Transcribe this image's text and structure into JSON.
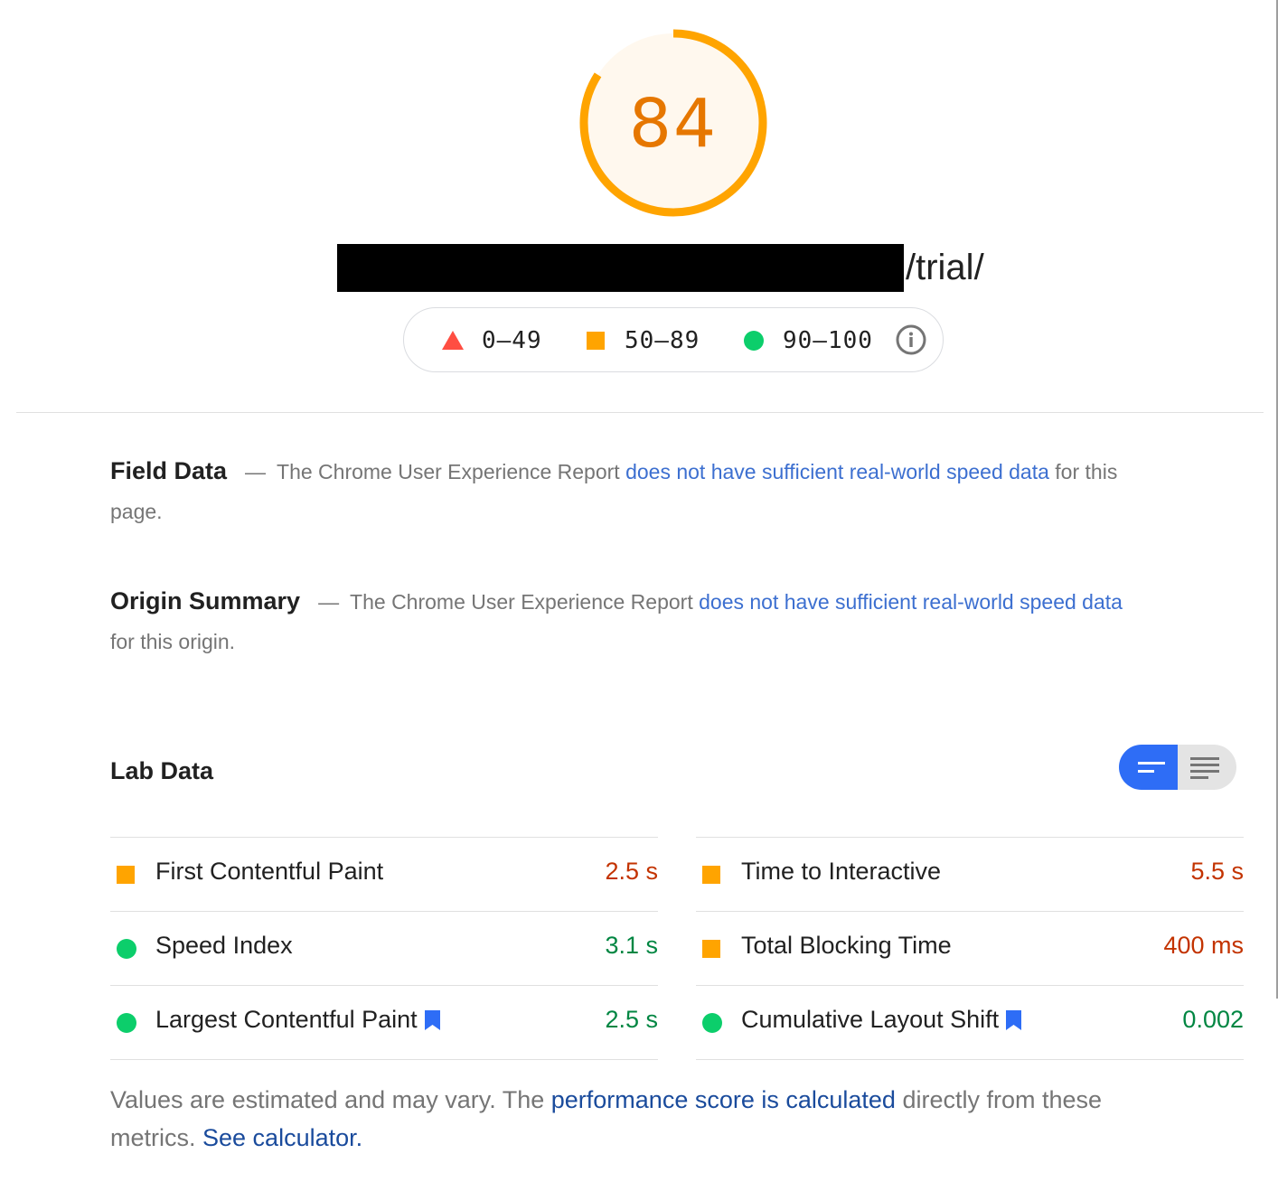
{
  "gauge": {
    "score": "84",
    "progress_fraction": 0.84,
    "ring_color": "#ffa400",
    "fill_color": "#fff8ee"
  },
  "url": {
    "path": "/trial/"
  },
  "legend": {
    "ranges": [
      {
        "label": "0–49",
        "icon": "red-triangle-icon",
        "color": "#ff4e42"
      },
      {
        "label": "50–89",
        "icon": "orange-square-icon",
        "color": "#ffa400"
      },
      {
        "label": "90–100",
        "icon": "green-circle-icon",
        "color": "#0cce6b"
      }
    ],
    "info_icon": "info-icon"
  },
  "field_data": {
    "heading": "Field Data",
    "dash": "—",
    "text_before": "The Chrome User Experience Report",
    "link": "does not have sufficient real-world speed data",
    "text_after": "for this page."
  },
  "origin_summary": {
    "heading": "Origin Summary",
    "dash": "—",
    "text_before": "The Chrome User Experience Report",
    "link": "does not have sufficient real-world speed data",
    "text_after": "for this origin."
  },
  "lab_data": {
    "heading": "Lab Data",
    "toggle": {
      "selected": "summary-view",
      "options": [
        "summary-view-icon",
        "detail-view-icon"
      ]
    },
    "metrics_left": [
      {
        "label": "First Contentful Paint",
        "value": "2.5 s",
        "rating": "average",
        "bookmark": false
      },
      {
        "label": "Speed Index",
        "value": "3.1 s",
        "rating": "good",
        "bookmark": false
      },
      {
        "label": "Largest Contentful Paint",
        "value": "2.5 s",
        "rating": "good",
        "bookmark": true
      }
    ],
    "metrics_right": [
      {
        "label": "Time to Interactive",
        "value": "5.5 s",
        "rating": "average",
        "bookmark": false
      },
      {
        "label": "Total Blocking Time",
        "value": "400 ms",
        "rating": "average",
        "bookmark": false
      },
      {
        "label": "Cumulative Layout Shift",
        "value": "0.002",
        "rating": "good",
        "bookmark": true
      }
    ]
  },
  "footnote": {
    "text1": "Values are estimated and may vary. The",
    "link1": "performance score is calculated",
    "text2": "directly from these metrics.",
    "link2": "See calculator."
  }
}
